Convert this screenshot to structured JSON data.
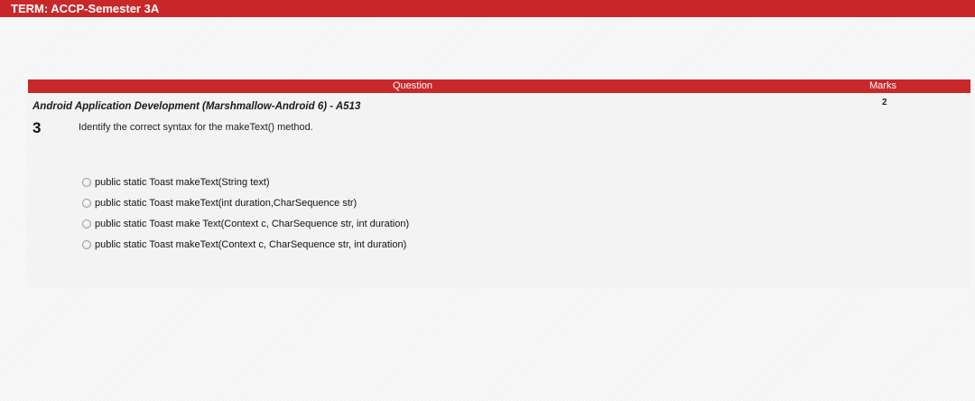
{
  "term_bar": {
    "title": "TERM: ACCP-Semester 3A"
  },
  "table": {
    "header_question": "Question",
    "header_marks": "Marks",
    "subject": "Android Application Development (Marshmallow-Android 6) - A513",
    "marks_value": "2"
  },
  "question": {
    "number": "3",
    "text": "Identify the correct syntax for the makeText() method.",
    "options": [
      {
        "label": "public static Toast makeText(String text)"
      },
      {
        "label": "public static Toast makeText(int duration,CharSequence str)"
      },
      {
        "label": "public static Toast make Text(Context c, CharSequence str, int duration)"
      },
      {
        "label": "public static Toast makeText(Context c, CharSequence str, int duration)"
      }
    ]
  },
  "colors": {
    "header_red": "#c8282a",
    "panel_bg": "#f3f3f3"
  }
}
